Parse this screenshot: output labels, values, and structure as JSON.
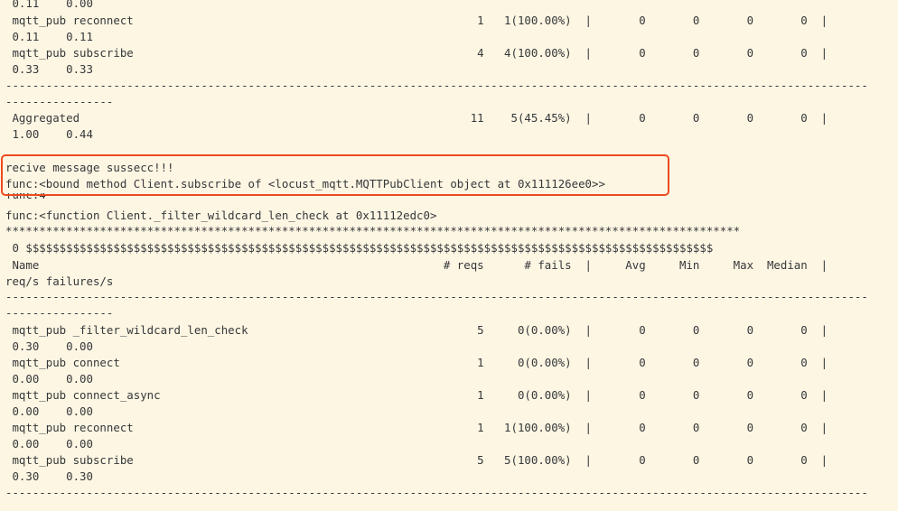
{
  "terminal": {
    "lines": [
      " 0.11    0.00",
      " mqtt_pub reconnect                                                   1   1(100.00%)  |       0       0       0       0  |",
      " 0.11    0.11",
      " mqtt_pub subscribe                                                   4   4(100.00%)  |       0       0       0       0  |",
      " 0.33    0.33",
      "--------------------------------------------------------------------------------------------------------------------------------",
      "----------------",
      " Aggregated                                                          11    5(45.45%)  |       0       0       0       0  |",
      " 1.00    0.44",
      "recive message sussecc!!!",
      "func:<bound method Client.subscribe of <locust_mqtt.MQTTPubClient object at 0x111126ee0>>",
      "func:4",
      "func:<function Client._filter_wildcard_len_check at 0x11112edc0>",
      "*************************************************************************************************************",
      " 0 $$$$$$$$$$$$$$$$$$$$$$$$$$$$$$$$$$$$$$$$$$$$$$$$$$$$$$$$$$$$$$$$$$$$$$$$$$$$$$$$$$$$$$$$$$$$$$$$$$$$$$",
      " Name                                                            # reqs      # fails  |     Avg     Min     Max  Median  |",
      "req/s failures/s",
      "--------------------------------------------------------------------------------------------------------------------------------",
      "----------------",
      " mqtt_pub _filter_wildcard_len_check                                  5     0(0.00%)  |       0       0       0       0  |",
      " 0.30    0.00",
      " mqtt_pub connect                                                     1     0(0.00%)  |       0       0       0       0  |",
      " 0.00    0.00",
      " mqtt_pub connect_async                                               1     0(0.00%)  |       0       0       0       0  |",
      " 0.00    0.00",
      " mqtt_pub reconnect                                                   1   1(100.00%)  |       0       0       0       0  |",
      " 0.00    0.00",
      " mqtt_pub subscribe                                                   5   5(100.00%)  |       0       0       0       0  |",
      " 0.30    0.30",
      "--------------------------------------------------------------------------------------------------------------------------------"
    ]
  }
}
